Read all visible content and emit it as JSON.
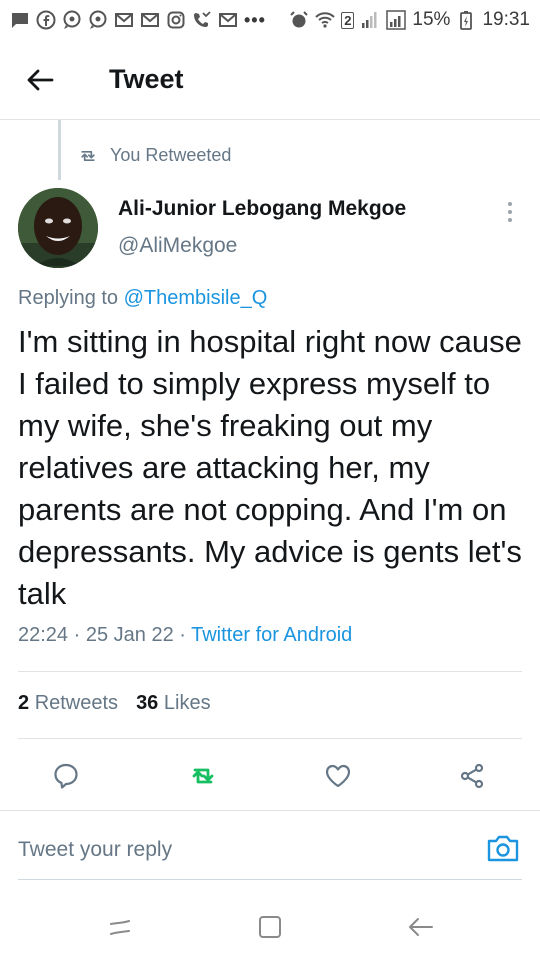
{
  "status_bar": {
    "battery_percent": "15%",
    "time": "19:31",
    "sim_badge": "2",
    "overflow_dots": "•••",
    "icons": [
      "message-icon",
      "facebook-icon",
      "chat-icon",
      "chat-icon",
      "gmail-icon",
      "gmail-icon",
      "instagram-icon",
      "missed-call-icon",
      "gmail-icon",
      "alarm-icon",
      "wifi-icon",
      "signal-icon",
      "signal-icon",
      "battery-icon"
    ]
  },
  "header": {
    "title": "Tweet",
    "back_icon": "arrow-left-icon"
  },
  "tweet": {
    "retweet_context": "You Retweeted",
    "author_name": "Ali-Junior Lebogang Mekgoe",
    "author_handle": "@AliMekgoe",
    "replying_prefix": "Replying to ",
    "replying_to": "@Thembisile_Q",
    "text": "I'm sitting in hospital right now cause I failed to simply express myself to my wife, she's freaking out my relatives are attacking her, my parents are not copping. And I'm on depressants. My advice is gents let's talk",
    "time": "22:24",
    "sep1": " · ",
    "date": "25 Jan 22",
    "sep2": " · ",
    "source": "Twitter for Android",
    "retweets_count": "2",
    "retweets_label": "Retweets",
    "likes_count": "36",
    "likes_label": "Likes"
  },
  "actions": {
    "reply_icon": "reply-icon",
    "retweet_icon": "retweet-icon",
    "like_icon": "heart-icon",
    "share_icon": "share-icon",
    "retweet_active_color": "#17bf63"
  },
  "reply_bar": {
    "placeholder": "Tweet your reply",
    "camera_icon": "camera-icon"
  },
  "colors": {
    "accent": "#1b95e0",
    "secondary_text": "#657786",
    "primary_text": "#14171a",
    "divider": "#dfe3e6"
  }
}
